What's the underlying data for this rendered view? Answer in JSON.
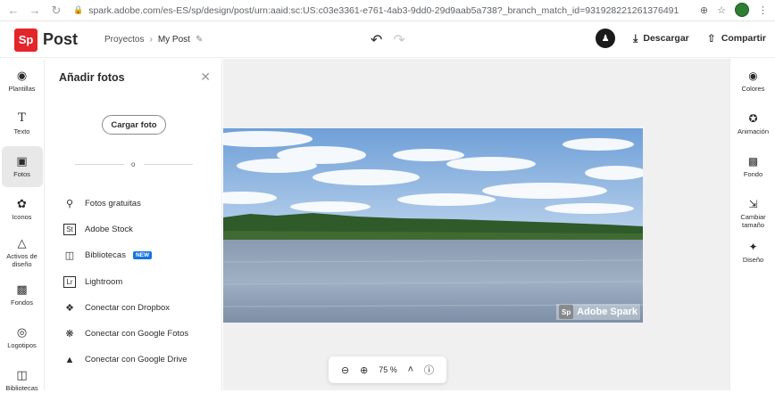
{
  "browser": {
    "url": "spark.adobe.com/es-ES/sp/design/post/urn:aaid:sc:US:c03e3361-e761-4ab3-9dd0-29d9aab5a738?_branch_match_id=931928221261376491"
  },
  "header": {
    "logo_mark": "Sp",
    "product": "Post",
    "breadcrumb_root": "Proyectos",
    "breadcrumb_sep": "›",
    "breadcrumb_current": "My Post",
    "download_label": "Descargar",
    "share_label": "Compartir"
  },
  "left_rail": {
    "items": [
      {
        "label": "Plantillas",
        "icon": "palette-icon"
      },
      {
        "label": "Texto",
        "icon": "text-icon"
      },
      {
        "label": "Fotos",
        "icon": "image-icon"
      },
      {
        "label": "Iconos",
        "icon": "shape-icon"
      },
      {
        "label": "Activos de diseño",
        "icon": "assets-icon"
      },
      {
        "label": "Fondos",
        "icon": "background-icon"
      },
      {
        "label": "Logotipos",
        "icon": "logo-icon"
      },
      {
        "label": "Bibliotecas",
        "icon": "library-icon"
      }
    ],
    "active": "Fotos"
  },
  "panel": {
    "title": "Añadir fotos",
    "upload_label": "Cargar foto",
    "or_text": "o",
    "sources": [
      {
        "label": "Fotos gratuitas",
        "icon": "search-icon"
      },
      {
        "label": "Adobe Stock",
        "icon": "stock-icon",
        "icon_text": "St"
      },
      {
        "label": "Bibliotecas",
        "icon": "library-icon",
        "badge": "NEW"
      },
      {
        "label": "Lightroom",
        "icon": "lightroom-icon",
        "icon_text": "Lr"
      },
      {
        "label": "Conectar con Dropbox",
        "icon": "dropbox-icon"
      },
      {
        "label": "Conectar con Google Fotos",
        "icon": "google-photos-icon"
      },
      {
        "label": "Conectar con Google Drive",
        "icon": "google-drive-icon"
      }
    ]
  },
  "canvas": {
    "watermark_mark": "Sp",
    "watermark_text": "Adobe Spark",
    "zoom_value": "75 %"
  },
  "right_rail": {
    "items": [
      {
        "label": "Colores",
        "icon": "palette-icon"
      },
      {
        "label": "Animación",
        "icon": "animation-icon"
      },
      {
        "label": "Fondo",
        "icon": "background-icon"
      },
      {
        "label": "Cambiar tamaño",
        "icon": "resize-icon"
      },
      {
        "label": "Diseño",
        "icon": "magic-wand-icon"
      }
    ]
  },
  "colors": {
    "brand": "#e4252a",
    "badge": "#1473e6"
  }
}
